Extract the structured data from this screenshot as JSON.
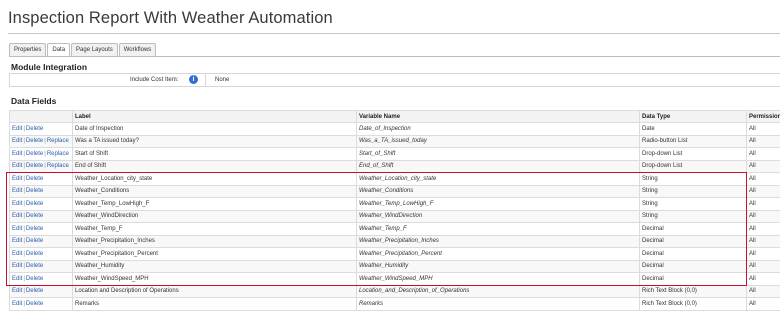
{
  "page": {
    "title": "Inspection Report With Weather Automation"
  },
  "tabs": [
    {
      "label": "Properties",
      "active": false
    },
    {
      "label": "Data",
      "active": true
    },
    {
      "label": "Page Layouts",
      "active": false
    },
    {
      "label": "Workflows",
      "active": false
    }
  ],
  "module_integration": {
    "heading": "Module Integration",
    "include_cost_item_label": "Include Cost Item:",
    "info_icon": "i",
    "include_cost_item_value": "None"
  },
  "data_fields": {
    "heading": "Data Fields",
    "columns": [
      "",
      "Label",
      "Variable Name",
      "Data Type",
      "Permission"
    ],
    "actions": {
      "edit": "Edit",
      "delete": "Delete",
      "replace": "Replace",
      "separator": "|"
    },
    "rows": [
      {
        "label": "Date of Inspection",
        "variable": "Date_of_Inspection",
        "type": "Date",
        "permission": "All",
        "replace": false
      },
      {
        "label": "Was a TA issued today?",
        "variable": "Was_a_TA_issued_today",
        "type": "Radio-button List",
        "permission": "All",
        "replace": true
      },
      {
        "label": "Start of Shift",
        "variable": "Start_of_Shift",
        "type": "Drop-down List",
        "permission": "All",
        "replace": true
      },
      {
        "label": "End of Shift",
        "variable": "End_of_Shift",
        "type": "Drop-down List",
        "permission": "All",
        "replace": true
      },
      {
        "label": "Weather_Location_city_state",
        "variable": "Weather_Location_city_state",
        "type": "String",
        "permission": "All",
        "replace": false
      },
      {
        "label": "Weather_Conditions",
        "variable": "Weather_Conditions",
        "type": "String",
        "permission": "All",
        "replace": false
      },
      {
        "label": "Weather_Temp_LowHigh_F",
        "variable": "Weather_Temp_LowHigh_F",
        "type": "String",
        "permission": "All",
        "replace": false
      },
      {
        "label": "Weather_WindDirection",
        "variable": "Weather_WindDirection",
        "type": "String",
        "permission": "All",
        "replace": false
      },
      {
        "label": "Weather_Temp_F",
        "variable": "Weather_Temp_F",
        "type": "Decimal",
        "permission": "All",
        "replace": false
      },
      {
        "label": "Weather_Precipitation_Inches",
        "variable": "Weather_Precipitation_Inches",
        "type": "Decimal",
        "permission": "All",
        "replace": false
      },
      {
        "label": "Weather_Precipitation_Percent",
        "variable": "Weather_Precipitation_Percent",
        "type": "Decimal",
        "permission": "All",
        "replace": false
      },
      {
        "label": "Weather_Humidity",
        "variable": "Weather_Humidity",
        "type": "Decimal",
        "permission": "All",
        "replace": false
      },
      {
        "label": "Weather_WindSpeed_MPH",
        "variable": "Weather_WindSpeed_MPH",
        "type": "Decimal",
        "permission": "All",
        "replace": false
      },
      {
        "label": "Location and Description of Operations",
        "variable": "Location_and_Description_of_Operations",
        "type": "Rich Text Block (0,0)",
        "permission": "All",
        "replace": false
      },
      {
        "label": "Remarks",
        "variable": "Remarks",
        "type": "Rich Text Block (0,0)",
        "permission": "All",
        "replace": false
      }
    ]
  },
  "colors": {
    "link": "#2a5db0",
    "highlight": "#c8102e",
    "info": "#2f6fd6"
  }
}
